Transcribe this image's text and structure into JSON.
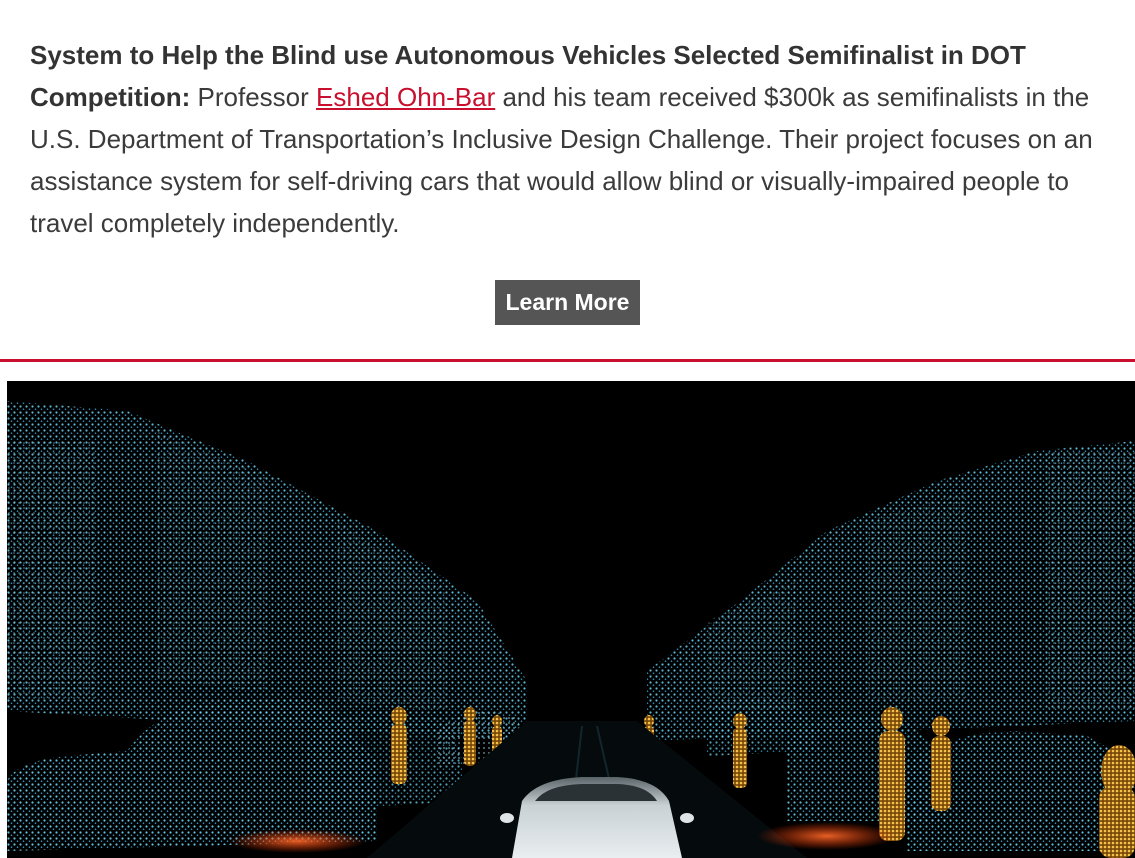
{
  "story": {
    "headline": "System to Help the Blind use Autonomous Vehicles Selected Semifinalist in DOT Competition:",
    "text_before_link": " Professor ",
    "link_text": "Eshed Ohn-Bar",
    "text_after_link": " and his team received $300k as semifinalists in the U.S. Department of Transportation’s Inclusive Design Challenge. Their project focuses on an assistance system for self-driving cars that would allow blind or visually-impaired people to travel completely independently."
  },
  "cta": {
    "label": "Learn More"
  },
  "colors": {
    "accent": "#c8102e",
    "button_bg": "#555555",
    "body_text": "#3b3b3b",
    "point_cloud": "#5fd0f0",
    "pedestrian": "#f2b233"
  },
  "hero_image": {
    "icon": "lidar-point-cloud-street-image"
  }
}
